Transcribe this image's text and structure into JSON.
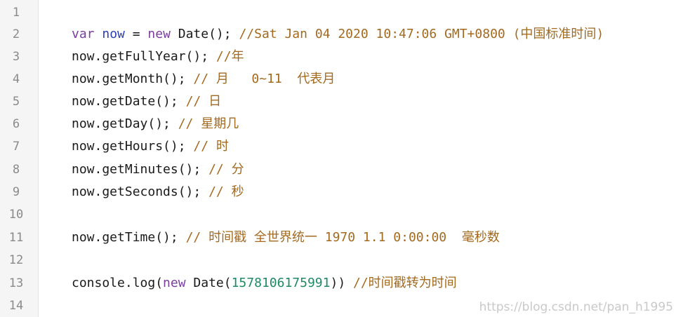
{
  "lines": [
    {
      "n": "1"
    },
    {
      "n": "2",
      "t1": "var",
      "t2": " now",
      "t3": " = ",
      "t4": "new",
      "t5": " Date(); ",
      "t6": "//Sat Jan 04 2020 10:47:06 GMT+0800 (中国标准时间)"
    },
    {
      "n": "3",
      "a": "now.getFullYear(); ",
      "c": "//年"
    },
    {
      "n": "4",
      "a": "now.getMonth(); ",
      "c": "// 月   0~11  代表月"
    },
    {
      "n": "5",
      "a": "now.getDate(); ",
      "c": "// 日"
    },
    {
      "n": "6",
      "a": "now.getDay(); ",
      "c": "// 星期几"
    },
    {
      "n": "7",
      "a": "now.getHours(); ",
      "c": "// 时"
    },
    {
      "n": "8",
      "a": "now.getMinutes(); ",
      "c": "// 分"
    },
    {
      "n": "9",
      "a": "now.getSeconds(); ",
      "c": "// 秒"
    },
    {
      "n": "10"
    },
    {
      "n": "11",
      "a": "now.getTime(); ",
      "c": "// 时间戳 全世界统一 ",
      "num": "1970 1.1 0:00:00",
      "c2": "  毫秒数"
    },
    {
      "n": "12"
    },
    {
      "n": "13",
      "a": "console.log(",
      "k": "new",
      "b": " Date(",
      "num": "1578106175991",
      "d": ")) ",
      "c": "//时间戳转为时间"
    },
    {
      "n": "14"
    }
  ],
  "watermark": "https://blog.csdn.net/pan_h1995"
}
